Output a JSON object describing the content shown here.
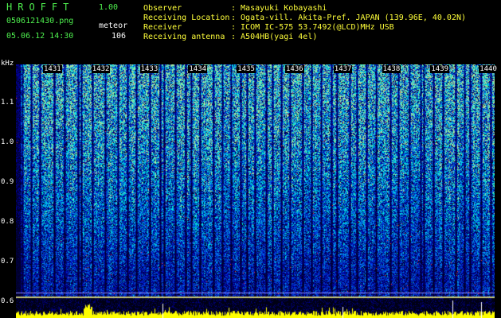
{
  "header": {
    "app_title": "HROFFT",
    "version": "1.00",
    "filename": "0506121430.png",
    "datetime": "05.06.12 14:30",
    "mode_label": "meteor",
    "meteor_count": "106",
    "fields": [
      {
        "label": "Observer",
        "value": ": Masayuki Kobayashi"
      },
      {
        "label": "Receiving Location",
        "value": ": Ogata-vill. Akita-Pref. JAPAN (139.96E, 40.02N)"
      },
      {
        "label": "Receiver",
        "value": ": ICOM IC-575 53.7492(@LCD)MHz USB"
      },
      {
        "label": "Receiving antenna",
        "value": ": A504HB(yagi 4el)"
      }
    ]
  },
  "spectrogram": {
    "freq_unit": "kHz",
    "freq_ticks": [
      "1.1",
      "1.0",
      "0.9",
      "0.8",
      "0.7",
      "0.6"
    ],
    "minute_labels": [
      "1431",
      "1432",
      "1433",
      "1434",
      "1435",
      "1436",
      "1437",
      "1438",
      "1439",
      "1440"
    ],
    "colors": {
      "background": "#000000",
      "text": "#ffffff",
      "header_green": "#4ef04e",
      "header_yellow": "#ffff3a"
    }
  }
}
